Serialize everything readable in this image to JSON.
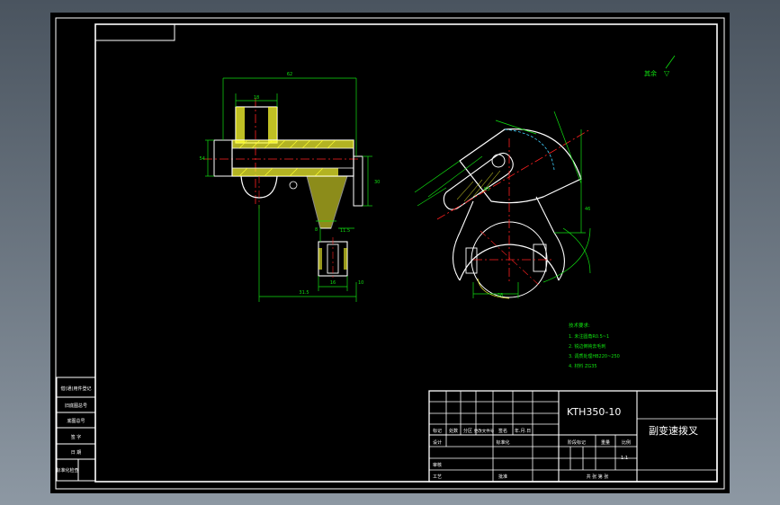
{
  "title_block": {
    "drawing_number": "KTH350-10",
    "part_name": "副变速拨叉",
    "scale": "1:1",
    "row_headers": [
      "标记",
      "处数",
      "分区",
      "更改文件号",
      "签名",
      "年.月.日"
    ],
    "design_label": "设计",
    "standardize_label": "标准化",
    "review_label": "审核",
    "process_label": "工艺",
    "approve_label": "批准",
    "stage_label": "阶段标记",
    "weight_label": "重量",
    "scale_label": "比例",
    "sheet_label": "共  张  第  张"
  },
  "side_panel": {
    "labels": [
      "借(通)用件登记",
      "旧底图总号",
      "底图总号",
      "签  字",
      "日  期",
      "标准化检查"
    ]
  },
  "roughness_note": {
    "label": "其余",
    "symbol": "▽"
  },
  "tech_notes": {
    "heading": "技术要求:",
    "items": [
      "1. 未注圆角R0.5~1",
      "2. 锐边倒钝去毛刺",
      "3. 调质处理HB220~250",
      "4. 材料 ZG35"
    ]
  },
  "dimensions": {
    "section_width": "62",
    "boss_width": "18",
    "left_height": "54",
    "right_height": "30",
    "slot_a": "8",
    "slot_b": "11.5",
    "slot_c": "16",
    "bottom_total": "31.5",
    "bottom_part": "10",
    "fork_radius": "R5",
    "fork_width": "28",
    "arm_height": "46"
  },
  "colors": {
    "background": "#000000",
    "outline": "#ffffff",
    "center": "#ff2020",
    "dim": "#10e010",
    "hatch": "#ffff30",
    "hidden": "#40d0ff"
  }
}
